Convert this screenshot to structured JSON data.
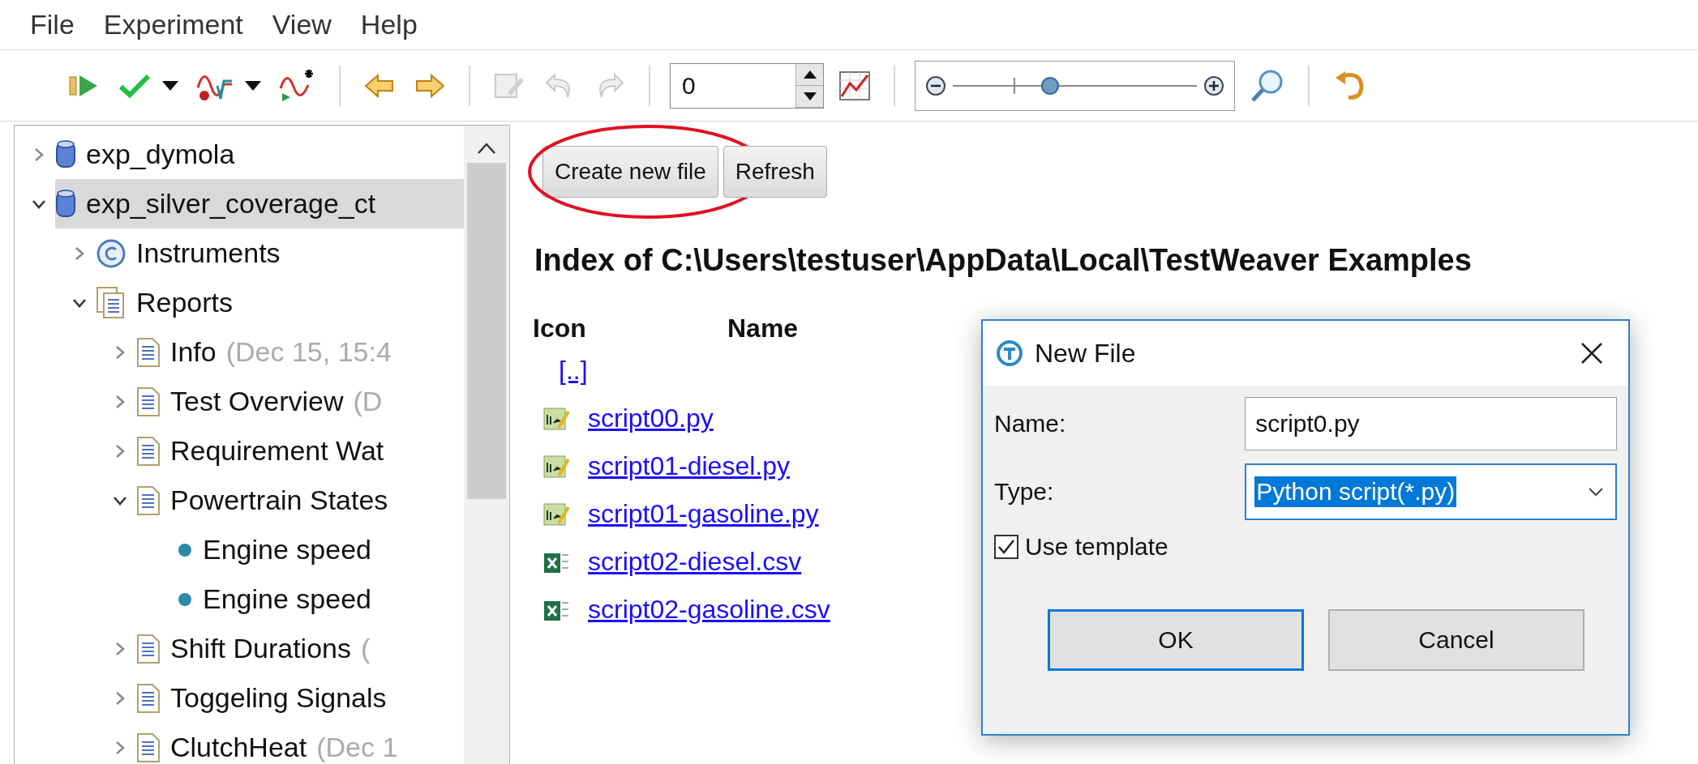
{
  "menu": [
    "File",
    "Experiment",
    "View",
    "Help"
  ],
  "toolbar": [
    {
      "kind": "button",
      "disabled": false
    },
    {
      "kind": "button",
      "disabled": false,
      "menu": true
    },
    {
      "kind": "button",
      "disabled": false,
      "menu": true
    },
    {
      "kind": "button",
      "disabled": false
    },
    {
      "kind": "separator"
    },
    {
      "kind": "button",
      "disabled": false
    },
    {
      "kind": "button",
      "disabled": false
    },
    {
      "kind": "separator"
    },
    {
      "kind": "button",
      "disabled": true
    },
    {
      "kind": "button",
      "disabled": true
    },
    {
      "kind": "button",
      "disabled": true
    },
    {
      "kind": "separator"
    },
    {
      "kind": "spin",
      "value": "0"
    },
    {
      "kind": "button",
      "disabled": false
    },
    {
      "kind": "separator"
    },
    {
      "kind": "zoom",
      "level": 0.4
    },
    {
      "kind": "button",
      "disabled": false
    },
    {
      "kind": "separator"
    },
    {
      "kind": "button",
      "disabled": false
    }
  ],
  "tree": [
    {
      "kind": "database",
      "label": "exp_dymola",
      "expanded": false,
      "selected": false
    },
    {
      "kind": "database",
      "label": "exp_silver_coverage_ct",
      "expanded": true,
      "selected": true,
      "children": [
        {
          "kind": "instruments",
          "label": "Instruments",
          "expanded": false,
          "selected": false
        },
        {
          "kind": "reports",
          "label": "Reports",
          "expanded": true,
          "selected": false,
          "children": [
            {
              "kind": "report",
              "label": "Info",
              "note": "(Dec 15, 15:4",
              "expanded": false,
              "selected": false
            },
            {
              "kind": "report",
              "label": "Test Overview",
              "note": "(D",
              "expanded": false,
              "selected": false
            },
            {
              "kind": "report",
              "label": "Requirement Wat",
              "expanded": false,
              "selected": false
            },
            {
              "kind": "report",
              "label": "Powertrain States",
              "expanded": true,
              "selected": false,
              "children": [
                {
                  "kind": "bullet",
                  "label": "Engine speed",
                  "selected": false
                },
                {
                  "kind": "bullet",
                  "label": "Engine speed",
                  "selected": false
                }
              ]
            },
            {
              "kind": "report",
              "label": "Shift Durations",
              "note": "(",
              "expanded": false,
              "selected": false
            },
            {
              "kind": "report",
              "label": "Toggeling Signals",
              "expanded": false,
              "selected": false
            },
            {
              "kind": "report",
              "label": "ClutchHeat",
              "note": "(Dec 1",
              "expanded": false,
              "selected": false
            }
          ]
        }
      ]
    }
  ],
  "actions": [
    {
      "label": "Create new file",
      "circled": true
    },
    {
      "label": "Refresh",
      "circled": false
    }
  ],
  "heading": "Index of C:\\Users\\testuser\\AppData\\Local\\TestWeaver Examples",
  "columns": [
    "Icon",
    "Name"
  ],
  "files": [
    {
      "kind": "parent",
      "name": "[..]"
    },
    {
      "kind": "python",
      "name": "script00.py"
    },
    {
      "kind": "python",
      "name": "script01-diesel.py"
    },
    {
      "kind": "python",
      "name": "script01-gasoline.py"
    },
    {
      "kind": "csv",
      "name": "script02-diesel.csv"
    },
    {
      "kind": "csv",
      "name": "script02-gasoline.csv"
    }
  ],
  "dialog": {
    "title": "New File",
    "name_field": {
      "label": "Name:",
      "value": "script0.py"
    },
    "type_field": {
      "label": "Type:",
      "value": "Python script(*.py)",
      "highlighted": true
    },
    "template": {
      "label": "Use template",
      "checked": true
    },
    "buttons": [
      {
        "label": "OK",
        "focused": true
      },
      {
        "label": "Cancel",
        "focused": false
      }
    ]
  }
}
